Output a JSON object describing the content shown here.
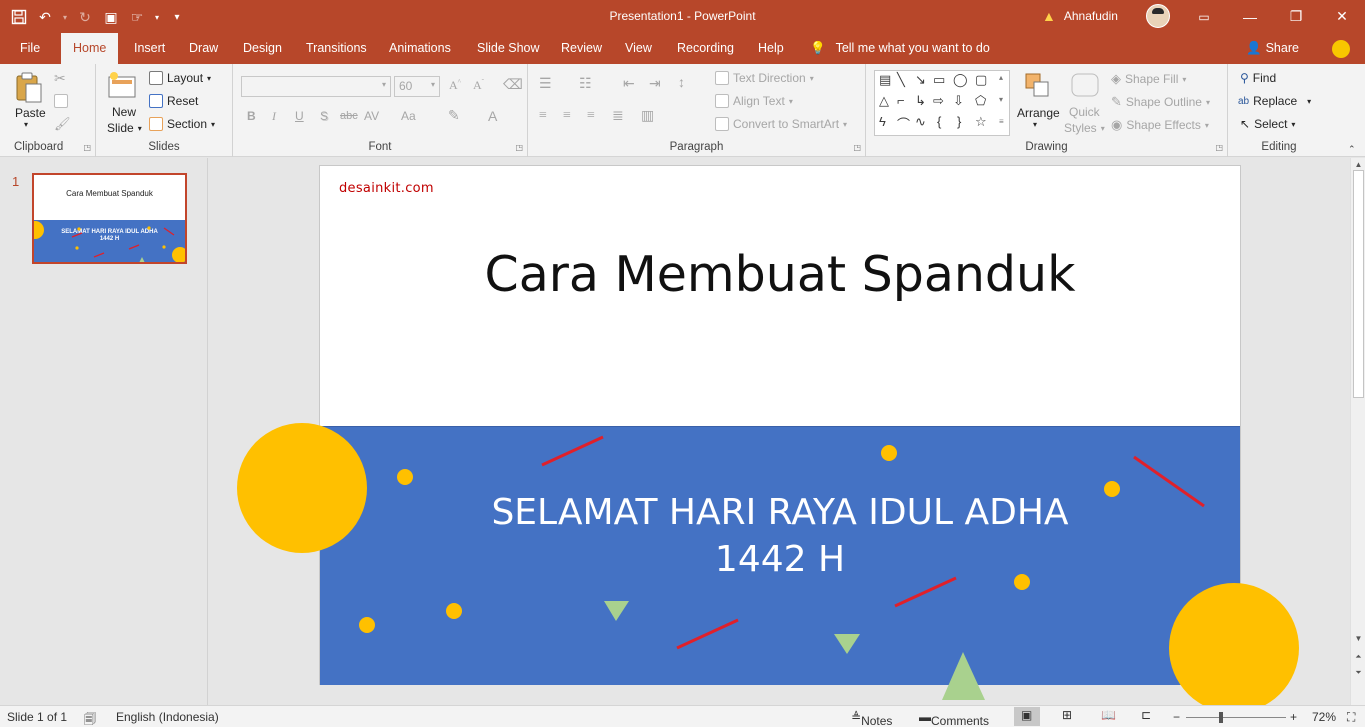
{
  "window": {
    "title": "Presentation1  -  PowerPoint",
    "user": "Ahnafudin",
    "min_glyph": "—",
    "restore_glyph": "❐",
    "close_glyph": "✕"
  },
  "qat": {
    "save": "💾",
    "undo": "↶",
    "redo": "↻",
    "present": "▣",
    "more": "▾"
  },
  "tabs": [
    {
      "label": "File"
    },
    {
      "label": "Home"
    },
    {
      "label": "Insert"
    },
    {
      "label": "Draw"
    },
    {
      "label": "Design"
    },
    {
      "label": "Transitions"
    },
    {
      "label": "Animations"
    },
    {
      "label": "Slide Show"
    },
    {
      "label": "Review"
    },
    {
      "label": "View"
    },
    {
      "label": "Recording"
    },
    {
      "label": "Help"
    }
  ],
  "tell_me": "Tell me what you want to do",
  "share": "Share",
  "ribbon": {
    "clipboard": {
      "label": "Clipboard",
      "paste": "Paste"
    },
    "slides": {
      "label": "Slides",
      "new_slide_1": "New",
      "new_slide_2": "Slide",
      "layout": "Layout",
      "reset": "Reset",
      "section": "Section"
    },
    "font": {
      "label": "Font",
      "size": "60",
      "bold": "B",
      "italic": "I",
      "underline": "U",
      "shadow": "S",
      "strike": "abc",
      "spacing": "AV",
      "case": "Aa",
      "color": "A"
    },
    "paragraph": {
      "label": "Paragraph",
      "text_direction": "Text Direction",
      "align_text": "Align Text",
      "convert": "Convert to SmartArt"
    },
    "drawing": {
      "label": "Drawing",
      "arrange": "Arrange",
      "quick_1": "Quick",
      "quick_2": "Styles",
      "shape_fill": "Shape Fill",
      "shape_outline": "Shape Outline",
      "shape_effects": "Shape Effects"
    },
    "editing": {
      "label": "Editing",
      "find": "Find",
      "replace": "Replace",
      "select": "Select"
    }
  },
  "thumbnail": {
    "number": "1",
    "title": "Cara Membuat Spanduk",
    "band_line1": "SELAMAT HARI RAYA IDUL ADHA",
    "band_line2": "1442 H"
  },
  "slide": {
    "watermark": "desainkit.com",
    "title": "Cara Membuat Spanduk",
    "band_line1": "SELAMAT HARI RAYA IDUL ADHA",
    "band_line2": "1442 H",
    "colors": {
      "band": "#4472c4",
      "circle": "#ffc000",
      "line": "#e0202a",
      "triangle": "#a9d18e",
      "watermark": "#c00000"
    }
  },
  "status": {
    "slide_info": "Slide 1 of 1",
    "language": "English (Indonesia)",
    "notes": "Notes",
    "comments": "Comments",
    "zoom": "72%"
  }
}
